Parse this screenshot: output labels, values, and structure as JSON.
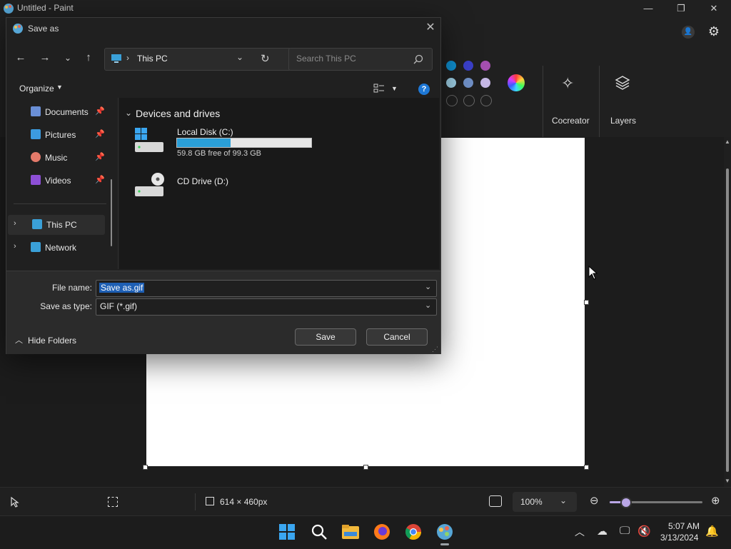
{
  "paint": {
    "title": "Untitled - Paint",
    "controls": {
      "minimize": "—",
      "maximize": "❐",
      "close": "✕"
    },
    "ribbon": {
      "cocreator_label": "Cocreator",
      "layers_label": "Layers",
      "swatches": [
        "#0f8fd0",
        "#3a3fc8",
        "#a44fb0",
        "#9ed0e6",
        "#6f8fc5",
        "#c6b8e6",
        "#202020",
        "#202020",
        "#202020"
      ]
    },
    "status": {
      "canvas_size": "614 × 460px",
      "zoom": "100%"
    }
  },
  "taskbar": {
    "time": "5:07 AM",
    "date": "3/13/2024"
  },
  "dialog": {
    "title": "Save as",
    "address": {
      "location": "This PC",
      "separator": "›"
    },
    "search": {
      "placeholder": "Search This PC"
    },
    "organize_label": "Organize",
    "nav": {
      "items": [
        {
          "label": "Documents",
          "color": "#6a8fd6"
        },
        {
          "label": "Pictures",
          "color": "#3c9be0"
        },
        {
          "label": "Music",
          "color": "#e47a6a"
        },
        {
          "label": "Videos",
          "color": "#8d4fd6"
        },
        {
          "label": "This PC",
          "color": "#3aa0d8"
        },
        {
          "label": "Network",
          "color": "#3aa0d8"
        }
      ]
    },
    "section_header": "Devices and drives",
    "drives": [
      {
        "name": "Local Disk (C:)",
        "free": "59.8 GB free of 99.3 GB",
        "used_fraction": 0.398
      },
      {
        "name": "CD Drive (D:)"
      }
    ],
    "file_name_label": "File name:",
    "file_name_value": "Save as.gif",
    "save_type_label": "Save as type:",
    "save_type_value": "GIF (*.gif)",
    "hide_folders_label": "Hide Folders",
    "save_button": "Save",
    "cancel_button": "Cancel"
  }
}
